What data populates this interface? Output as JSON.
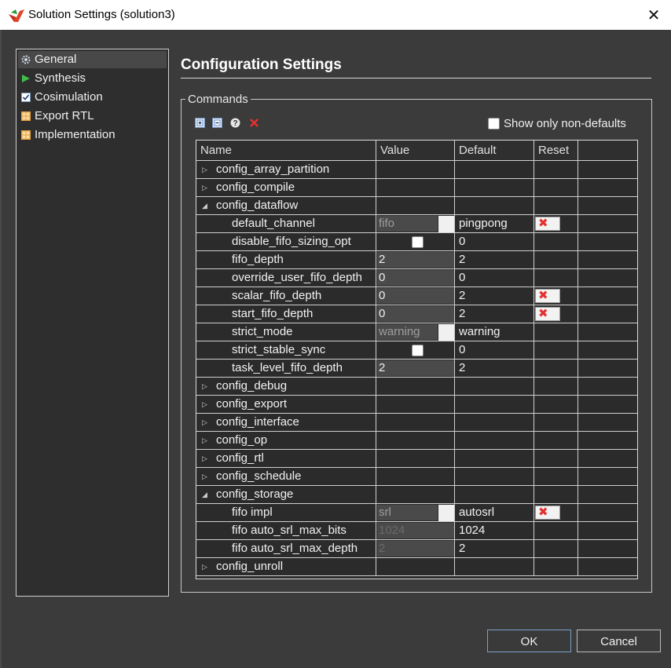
{
  "window": {
    "title": "Solution Settings (solution3)",
    "close_glyph": "✕"
  },
  "nav": {
    "items": [
      {
        "label": "General",
        "icon": "gear-icon",
        "selected": true
      },
      {
        "label": "Synthesis",
        "icon": "play-icon"
      },
      {
        "label": "Cosimulation",
        "icon": "checkbox-icon"
      },
      {
        "label": "Export RTL",
        "icon": "grid-icon"
      },
      {
        "label": "Implementation",
        "icon": "grid-icon"
      }
    ]
  },
  "main": {
    "heading": "Configuration Settings",
    "group_label": "Commands",
    "toolbar": {
      "icons": [
        "add-command-icon",
        "remove-command-icon",
        "help-icon",
        "delete-icon"
      ]
    },
    "show_only_non_defaults_label": "Show only non-defaults",
    "show_only_non_defaults_checked": false
  },
  "table": {
    "columns": [
      "Name",
      "Value",
      "Default",
      "Reset"
    ],
    "rows": [
      {
        "name": "config_array_partition",
        "group": true,
        "expanded": false
      },
      {
        "name": "config_compile",
        "group": true,
        "expanded": false
      },
      {
        "name": "config_dataflow",
        "group": true,
        "expanded": true
      },
      {
        "name": "default_channel",
        "value": "fifo",
        "value_type": "dropdown",
        "default": "pingpong",
        "reset": true
      },
      {
        "name": "disable_fifo_sizing_opt",
        "value_type": "checkbox",
        "checked": false,
        "default": "0",
        "reset": false
      },
      {
        "name": "fifo_depth",
        "value": "2",
        "value_type": "text",
        "default": "2",
        "reset": false
      },
      {
        "name": "override_user_fifo_depth",
        "value": "0",
        "value_type": "text",
        "default": "0",
        "reset": false
      },
      {
        "name": "scalar_fifo_depth",
        "value": "0",
        "value_type": "text",
        "default": "2",
        "reset": true
      },
      {
        "name": "start_fifo_depth",
        "value": "0",
        "value_type": "text",
        "default": "2",
        "reset": true
      },
      {
        "name": "strict_mode",
        "value": "warning",
        "value_type": "dropdown",
        "default": "warning",
        "reset": false
      },
      {
        "name": "strict_stable_sync",
        "value_type": "checkbox",
        "checked": false,
        "default": "0",
        "reset": false
      },
      {
        "name": "task_level_fifo_depth",
        "value": "2",
        "value_type": "text",
        "default": "2",
        "reset": false
      },
      {
        "name": "config_debug",
        "group": true,
        "expanded": false
      },
      {
        "name": "config_export",
        "group": true,
        "expanded": false
      },
      {
        "name": "config_interface",
        "group": true,
        "expanded": false
      },
      {
        "name": "config_op",
        "group": true,
        "expanded": false
      },
      {
        "name": "config_rtl",
        "group": true,
        "expanded": false
      },
      {
        "name": "config_schedule",
        "group": true,
        "expanded": false
      },
      {
        "name": "config_storage",
        "group": true,
        "expanded": true
      },
      {
        "name": "fifo impl",
        "value": "srl",
        "value_type": "dropdown",
        "default": "autosrl",
        "reset": true
      },
      {
        "name": "fifo auto_srl_max_bits",
        "value": "1024",
        "value_type": "disabled",
        "default": "1024",
        "reset": false
      },
      {
        "name": "fifo auto_srl_max_depth",
        "value": "2",
        "value_type": "disabled",
        "default": "2",
        "reset": false
      },
      {
        "name": "config_unroll",
        "group": true,
        "expanded": false
      }
    ]
  },
  "buttons": {
    "ok": "OK",
    "cancel": "Cancel"
  },
  "colors": {
    "background": "#3b3b3b",
    "panel": "#2b2b2b",
    "reset_x": "#e53030",
    "ok_border": "#7aa0c8"
  }
}
